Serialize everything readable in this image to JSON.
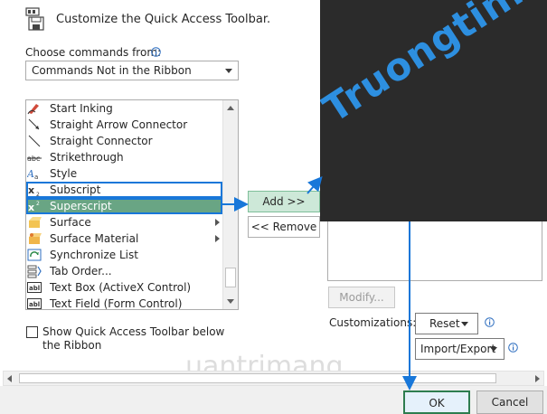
{
  "dialog": {
    "title": "Customize the Quick Access Toolbar.",
    "choose_label": "Choose commands from:",
    "choose_value": "Commands Not in the Ribbon"
  },
  "commands": [
    {
      "label": "Start Inking",
      "icon": "pen-icon",
      "submenu": false
    },
    {
      "label": "Straight Arrow Connector",
      "icon": "arrow-line-icon",
      "submenu": false
    },
    {
      "label": "Straight Connector",
      "icon": "line-icon",
      "submenu": false
    },
    {
      "label": "Strikethrough",
      "icon": "strikethrough-icon",
      "submenu": false
    },
    {
      "label": "Style",
      "icon": "style-icon",
      "submenu": false
    },
    {
      "label": "Subscript",
      "icon": "subscript-icon",
      "submenu": false
    },
    {
      "label": "Superscript",
      "icon": "superscript-icon",
      "submenu": false
    },
    {
      "label": "Surface",
      "icon": "surface-icon",
      "submenu": true
    },
    {
      "label": "Surface Material",
      "icon": "surface-material-icon",
      "submenu": true
    },
    {
      "label": "Synchronize List",
      "icon": "sync-list-icon",
      "submenu": false
    },
    {
      "label": "Tab Order...",
      "icon": "tab-order-icon",
      "submenu": false
    },
    {
      "label": "Text Box (ActiveX Control)",
      "icon": "textbox-icon",
      "submenu": false
    },
    {
      "label": "Text Field (Form Control)",
      "icon": "textfield-icon",
      "submenu": false
    }
  ],
  "selected_command": "Superscript",
  "buttons": {
    "add": "Add >>",
    "remove": "<< Remove",
    "modify": "Modify...",
    "reset": "Reset",
    "import_export": "Import/Export",
    "ok": "OK",
    "cancel": "Cancel"
  },
  "customizations_label": "Customizations:",
  "show_below_label": "Show Quick Access Toolbar below the Ribbon",
  "watermarks": {
    "overlay_text": "Truongtin.top",
    "logo_text": "uantrimang"
  },
  "colors": {
    "selection": "#69a584",
    "highlight_frame": "#1877d9",
    "overlay": "#2b2b2b",
    "ok_border": "#2e7d4f"
  }
}
